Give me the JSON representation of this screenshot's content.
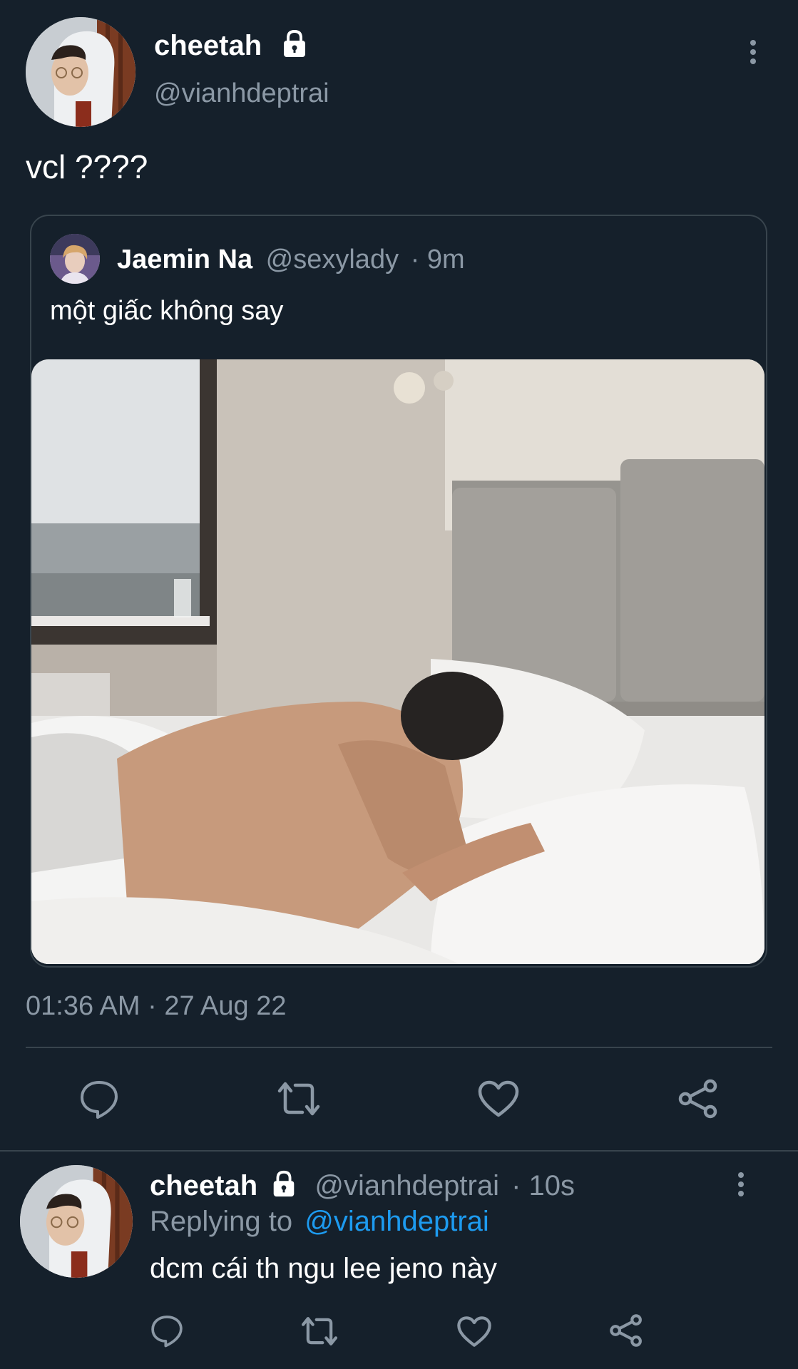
{
  "tweet": {
    "author_name": "cheetah",
    "author_handle": "@vianhdeptrai",
    "text": "vcl ????",
    "timestamp": "01:36 AM · 27 Aug 22",
    "lock_icon": "lock-icon",
    "more_icon": "more-vertical-icon"
  },
  "quoted_tweet": {
    "author_name": "Jaemin Na",
    "author_handle": "@sexylady",
    "time_ago": "· 9m",
    "text": "một giấc không say",
    "media": "bedroom-photo"
  },
  "actions": {
    "reply_icon": "reply-icon",
    "retweet_icon": "retweet-icon",
    "like_icon": "heart-icon",
    "share_icon": "share-icon"
  },
  "reply": {
    "author_name": "cheetah",
    "author_handle": "@vianhdeptrai",
    "time_ago": "· 10s",
    "replying_to_label": "Replying to",
    "replying_to_handle": "@vianhdeptrai",
    "text": "dcm cái th ngu lee jeno này"
  },
  "colors": {
    "background": "#15202b",
    "border": "#38444d",
    "secondary_text": "#8b98a5",
    "accent": "#1d9bf0"
  }
}
